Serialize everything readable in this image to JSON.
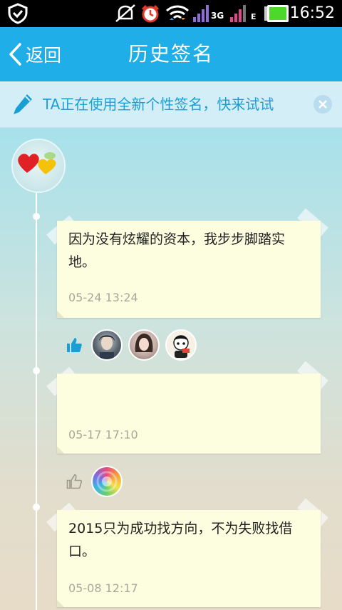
{
  "status_bar": {
    "time": "16:52",
    "network_label": "3G",
    "network_label_2": "E",
    "icons": [
      "shield-icon",
      "mute-icon",
      "alarm-icon",
      "wifi-icon",
      "signal-icon",
      "signal-icon-2",
      "battery-icon"
    ]
  },
  "header": {
    "back_label": "返回",
    "title": "历史签名"
  },
  "banner": {
    "text": "TA正在使用全新个性签名，快来试试"
  },
  "timeline": [
    {
      "text": "因为没有炫耀的资本，我步步脚踏实地。",
      "date": "05-24 13:24",
      "liked": true
    },
    {
      "text": "",
      "date": "05-17 17:10",
      "liked": false
    },
    {
      "text": "2015只为成功找方向，不为失败找借口。",
      "date": "05-08 12:17",
      "liked": false
    }
  ],
  "colors": {
    "accent": "#1faee8",
    "card": "#fdfde0",
    "date": "#a8a89a"
  }
}
